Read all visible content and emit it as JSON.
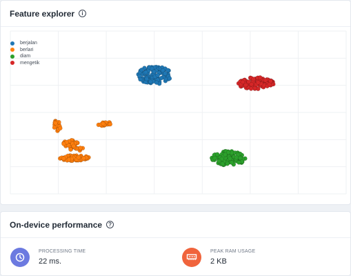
{
  "explorer": {
    "title": "Feature explorer",
    "legend": [
      {
        "label": "berjalan",
        "color": "#1f77b4"
      },
      {
        "label": "berlari",
        "color": "#ff7f0e"
      },
      {
        "label": "diam",
        "color": "#2ca02c"
      },
      {
        "label": "mengetik",
        "color": "#d62728"
      }
    ]
  },
  "performance": {
    "title": "On-device performance",
    "metrics": [
      {
        "label": "PROCESSING TIME",
        "value": "22 ms.",
        "icon": "clock-icon",
        "color": "#6c7ae0"
      },
      {
        "label": "PEAK RAM USAGE",
        "value": "2 KB",
        "icon": "ram-icon",
        "color": "#f0643c"
      }
    ]
  },
  "chart_data": {
    "type": "scatter",
    "title": "",
    "xlabel": "",
    "ylabel": "",
    "grid": true,
    "legend_position": "top-left",
    "xlim": [
      0,
      100
    ],
    "ylim": [
      0,
      100
    ],
    "series": [
      {
        "name": "berjalan",
        "color": "#1f77b4",
        "clusters": [
          {
            "cx": 43,
            "cy": 73,
            "rx": 5,
            "ry": 5.5,
            "n": 110
          }
        ]
      },
      {
        "name": "berlari",
        "color": "#ff7f0e",
        "clusters": [
          {
            "cx": 19,
            "cy": 22,
            "rx": 4.5,
            "ry": 1.6,
            "n": 60
          },
          {
            "cx": 18,
            "cy": 31,
            "rx": 2.2,
            "ry": 2.2,
            "n": 30
          },
          {
            "cx": 14,
            "cy": 42,
            "rx": 1.0,
            "ry": 3.5,
            "n": 20
          },
          {
            "cx": 28,
            "cy": 43,
            "rx": 2.5,
            "ry": 1.2,
            "n": 20
          },
          {
            "cx": 20,
            "cy": 28,
            "rx": 2.5,
            "ry": 1.5,
            "n": 15
          }
        ]
      },
      {
        "name": "diam",
        "color": "#2ca02c",
        "clusters": [
          {
            "cx": 65,
            "cy": 22,
            "rx": 5,
            "ry": 4.5,
            "n": 110
          }
        ]
      },
      {
        "name": "mengetik",
        "color": "#d62728",
        "clusters": [
          {
            "cx": 73,
            "cy": 68,
            "rx": 5.5,
            "ry": 3.6,
            "n": 110
          }
        ]
      }
    ]
  }
}
